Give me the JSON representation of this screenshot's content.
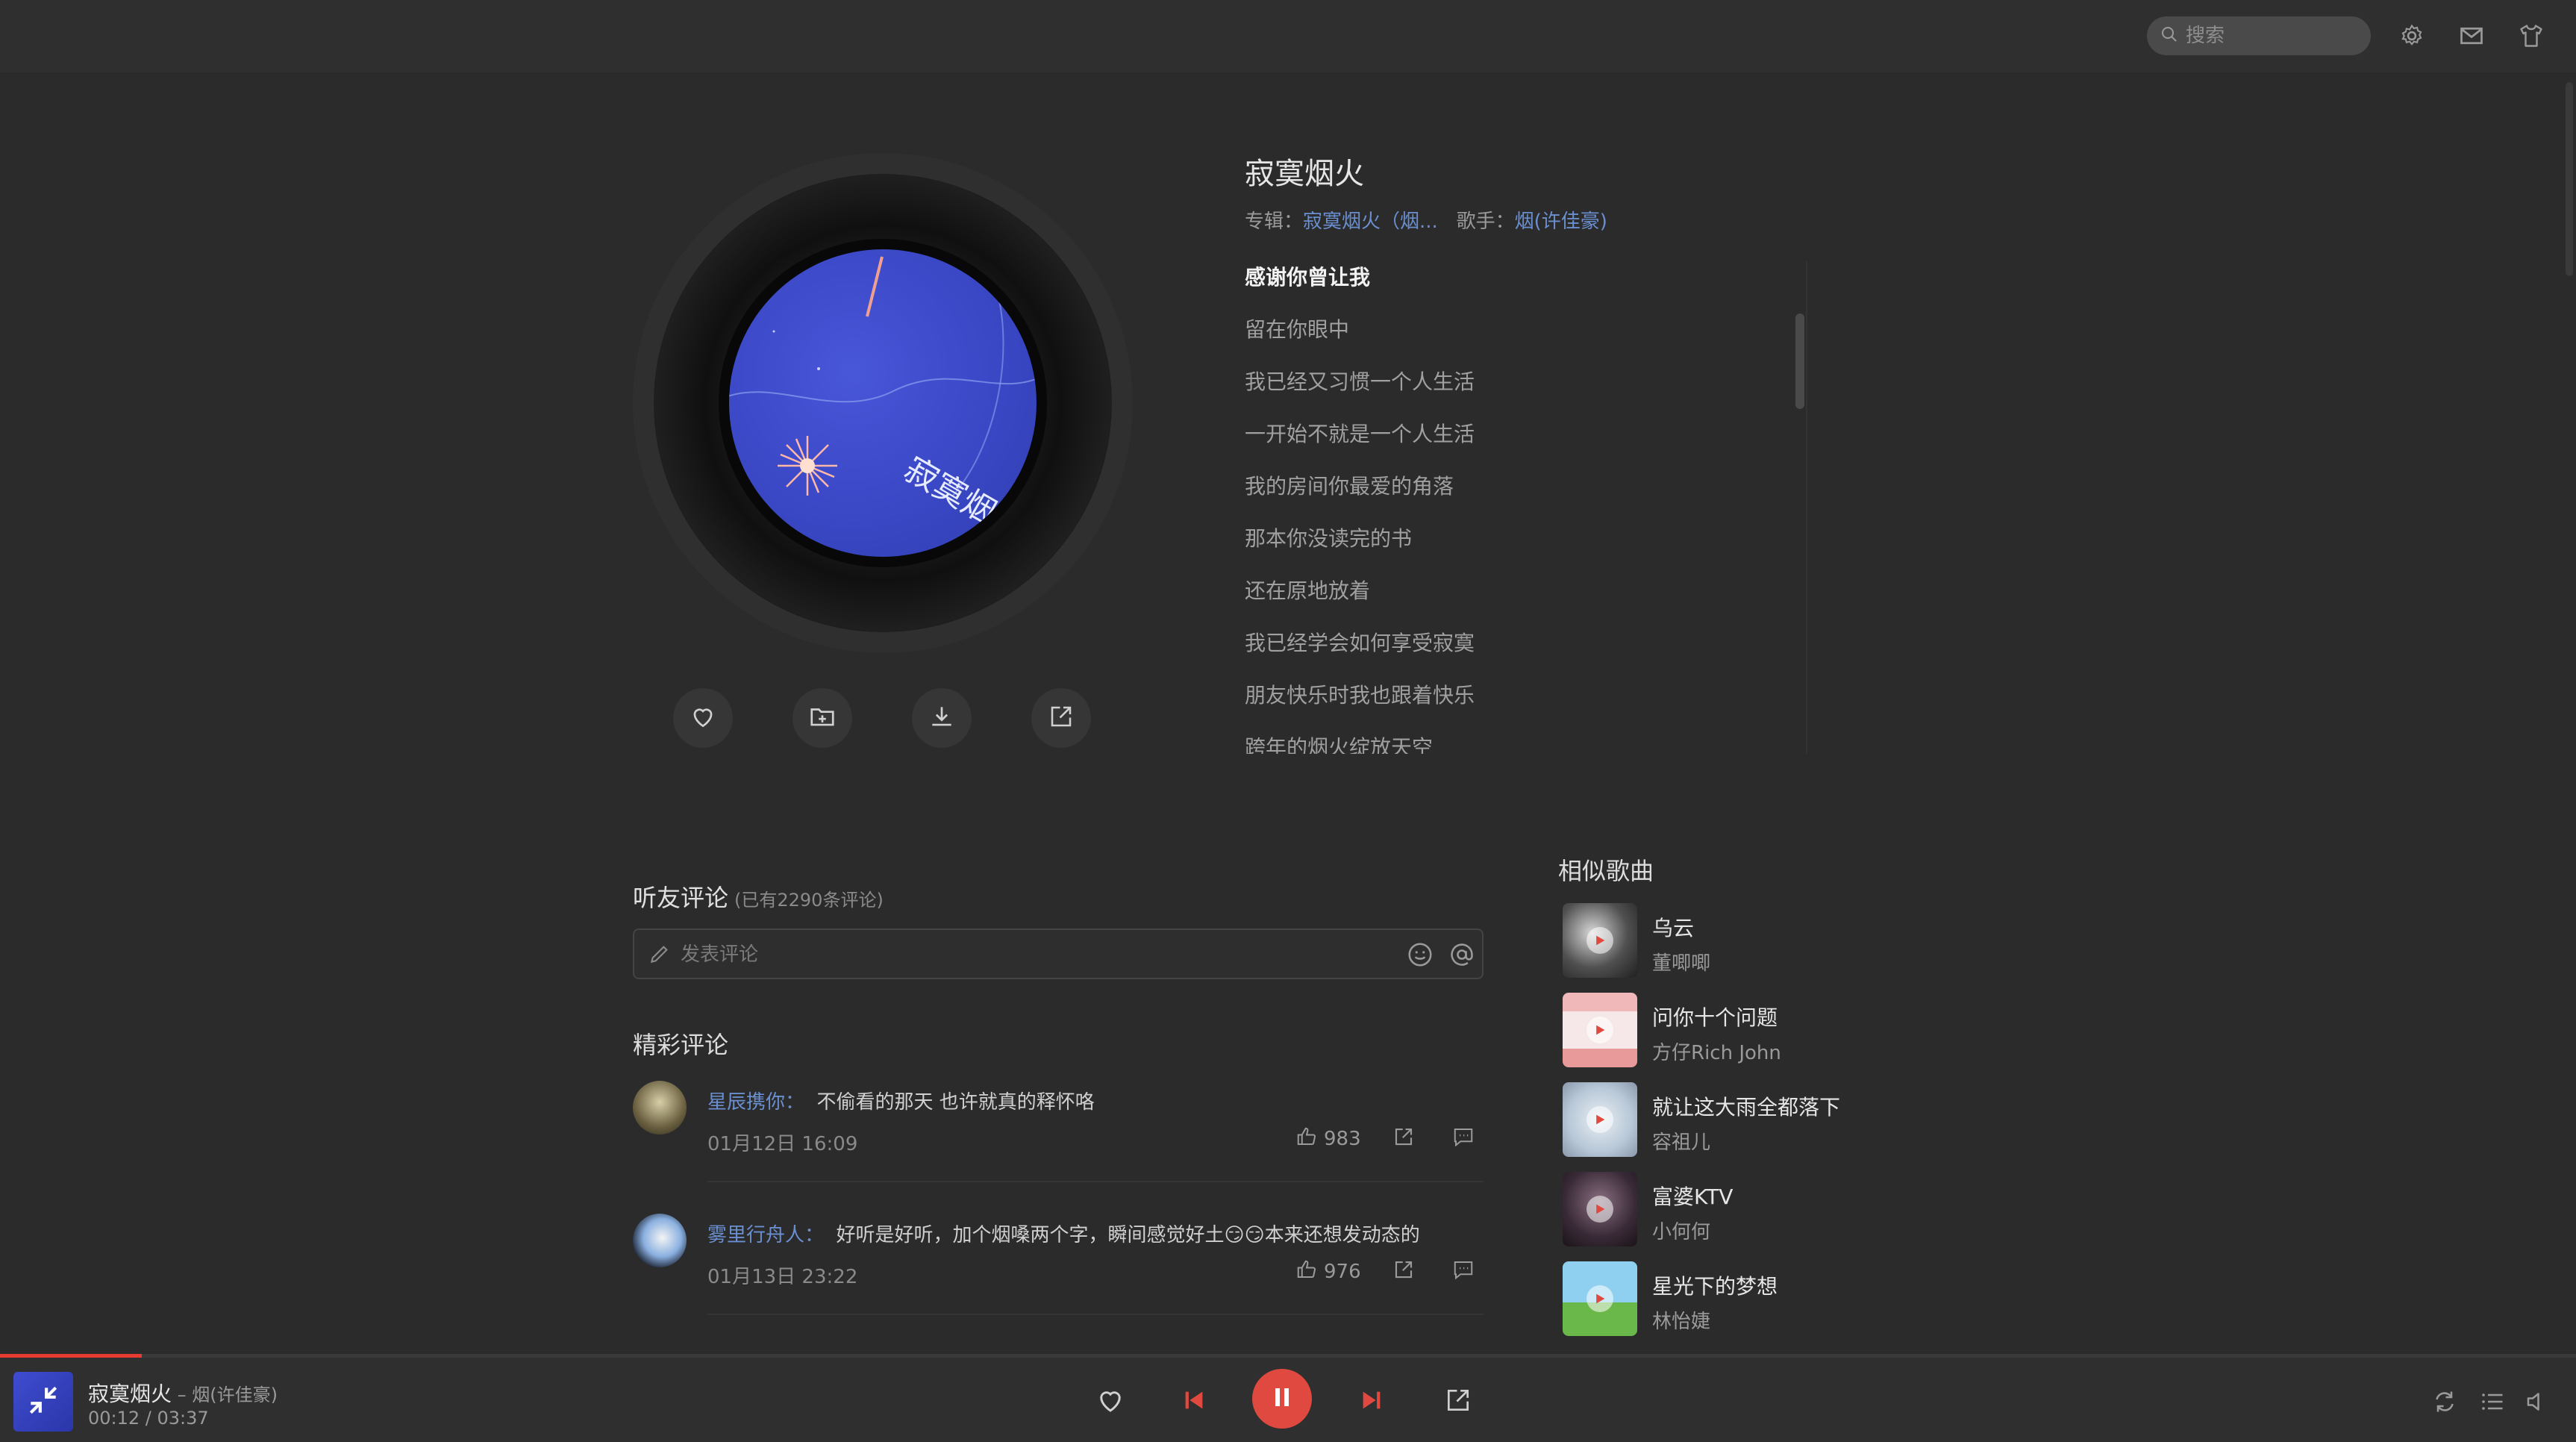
{
  "search": {
    "placeholder": "搜索"
  },
  "song": {
    "title": "寂寞烟火",
    "album_label": "专辑：",
    "album": "寂寞烟火（烟...",
    "artist_label": "歌手：",
    "artist": "烟(许佳豪)"
  },
  "lyrics": {
    "current_index": 0,
    "lines": [
      "感谢你曾让我",
      "留在你眼中",
      "我已经又习惯一个人生活",
      "一开始不就是一个人生活",
      "我的房间你最爱的角落",
      "那本你没读完的书",
      "还在原地放着",
      "我已经学会如何享受寂寞",
      "朋友快乐时我也跟着快乐",
      "跨年的烟火绽放天空"
    ]
  },
  "comments": {
    "title": "听友评论",
    "count": "(已有2290条评论)",
    "input_placeholder": "发表评论",
    "hot_title": "精彩评论",
    "items": [
      {
        "user": "星辰携你：",
        "text": "不偷看的那天 也许就真的释怀咯",
        "time": "01月12日 16:09",
        "likes": "983"
      },
      {
        "user": "雾里行舟人：",
        "text": "好听是好听，加个烟嗓两个字，瞬间感觉好土😏😏本来还想发动态的",
        "time": "01月13日 23:22",
        "likes": "976"
      }
    ]
  },
  "similar": {
    "title": "相似歌曲",
    "items": [
      {
        "name": "乌云",
        "artist": "董唧唧"
      },
      {
        "name": "问你十个问题",
        "artist": "方仔Rich John"
      },
      {
        "name": "就让这大雨全都落下",
        "artist": "容祖儿"
      },
      {
        "name": "富婆KTV",
        "artist": "小何何"
      },
      {
        "name": "星光下的梦想",
        "artist": "林怡婕"
      }
    ]
  },
  "player": {
    "title": "寂寞烟火",
    "artist": " – 烟(许佳豪)",
    "time": "00:12 / 03:37",
    "progress": 0.055
  },
  "colors": {
    "accent": "#e0493f",
    "link": "#6a8fd0",
    "cover_blue": "#3f4cd0"
  },
  "icons": [
    "search-icon",
    "settings-icon",
    "mail-icon",
    "skin-icon",
    "like-icon",
    "add-to-playlist-icon",
    "download-icon",
    "share-icon",
    "pencil-icon",
    "emoji-icon",
    "at-icon",
    "thumb-up-icon",
    "reply-icon",
    "play-icon",
    "prev-icon",
    "pause-icon",
    "next-icon",
    "loop-icon",
    "playlist-icon",
    "volume-icon",
    "collapse-icon"
  ]
}
